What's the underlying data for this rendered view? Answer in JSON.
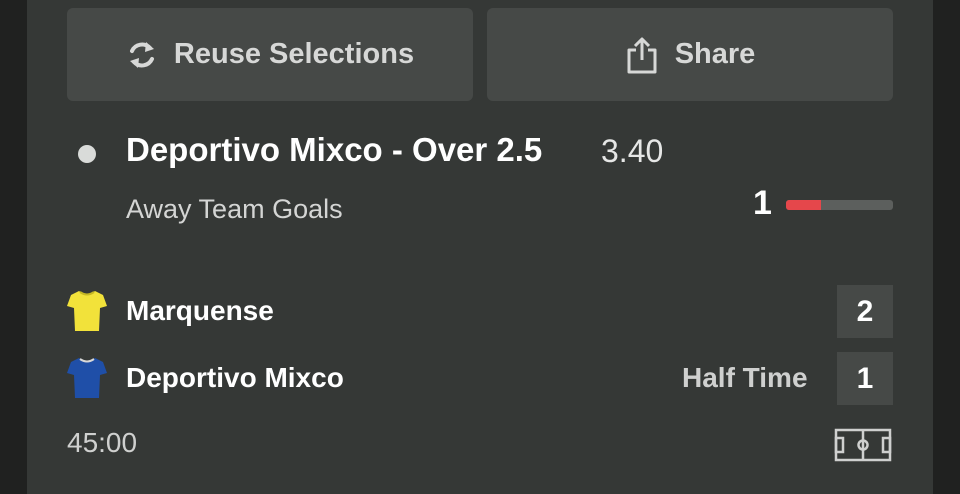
{
  "actions": {
    "reuse_label": "Reuse Selections",
    "share_label": "Share"
  },
  "selection": {
    "title": "Deportivo Mixco - Over 2.5",
    "odds": "3.40",
    "market": "Away Team Goals",
    "progress_count": "1",
    "progress_fraction": 0.33
  },
  "match": {
    "home": {
      "name": "Marquense",
      "score": "2",
      "jersey_color": "#f2e23a"
    },
    "away": {
      "name": "Deportivo Mixco",
      "score": "1",
      "jersey_color": "#1f4fa8"
    },
    "status": "Half Time",
    "clock": "45:00"
  },
  "colors": {
    "panel": "#353836",
    "button": "#464947",
    "progress": "#e5474b"
  },
  "icons": [
    "refresh-icon",
    "share-icon",
    "jersey-icon",
    "pitch-icon"
  ]
}
